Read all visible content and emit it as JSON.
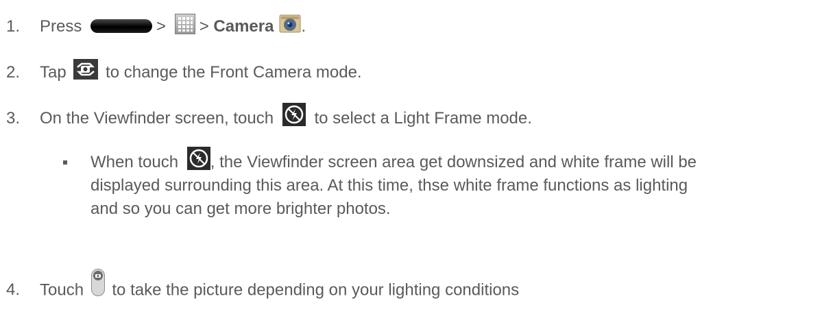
{
  "steps": [
    {
      "number": "1.",
      "press": "Press",
      "sep1": ">",
      "sep2": ">",
      "camera_label": "Camera",
      "period": "."
    },
    {
      "number": "2.",
      "before": "Tap",
      "after": "to change the Front Camera mode."
    },
    {
      "number": "3.",
      "before": "On the Viewfinder screen, touch",
      "after": "to select a Light Frame mode."
    },
    {
      "number": "4.",
      "before": "Touch",
      "after": "to take the picture depending on your lighting conditions"
    }
  ],
  "note": {
    "before": "When touch",
    "line1_after": ", the Viewfinder screen area get downsized and white frame will be",
    "line2": "displayed surrounding this area. At this time, thse white frame functions as lighting",
    "line3": "and so you can get more brighter photos."
  },
  "icons": {
    "home_key": "home-key-icon",
    "apps": "apps-grid-icon",
    "camera_app": "camera-app-icon",
    "switch_camera": "switch-camera-icon",
    "light_frame": "light-frame-icon",
    "shutter": "shutter-icon"
  }
}
